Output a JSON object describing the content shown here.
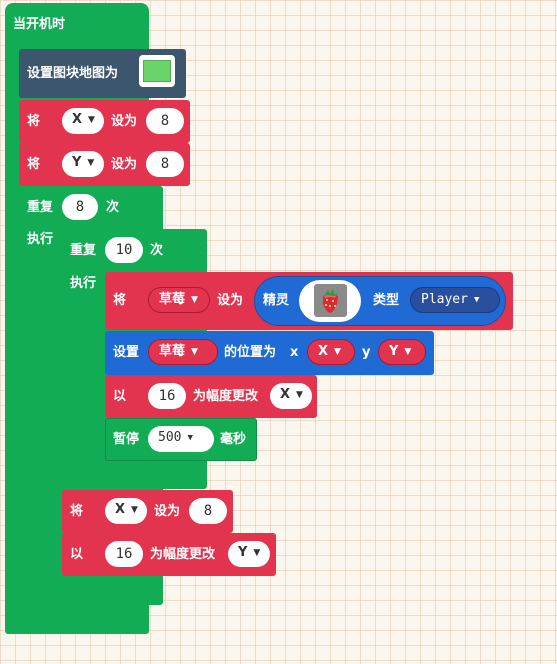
{
  "event": {
    "label": "当开机时"
  },
  "set_tilemap": {
    "label": "设置图块地图为",
    "preview_color": "#6ad36a"
  },
  "set_x": {
    "label": "将",
    "var": "X",
    "set_label": "设为",
    "value": "8"
  },
  "set_y": {
    "label": "将",
    "var": "Y",
    "set_label": "设为",
    "value": "8"
  },
  "outer_repeat": {
    "label": "重复",
    "count": "8",
    "times_label": "次",
    "do_label": "执行"
  },
  "inner_repeat": {
    "label": "重复",
    "count": "10",
    "times_label": "次",
    "do_label": "执行"
  },
  "set_sprite": {
    "label": "将",
    "var": "草莓",
    "set_label": "设为",
    "sprite_label": "精灵",
    "kind_label": "类型",
    "kind": "Player",
    "icon": "strawberry-icon"
  },
  "set_position": {
    "label": "设置",
    "var": "草莓",
    "pos_label": "的位置为",
    "x_label": "x",
    "x_var": "X",
    "y_label": "y",
    "y_var": "Y"
  },
  "change_x": {
    "label": "以",
    "amount": "16",
    "change_label": "为幅度更改",
    "var": "X"
  },
  "pause": {
    "label": "暂停",
    "ms": "500",
    "unit_label": "毫秒"
  },
  "reset_x": {
    "label": "将",
    "var": "X",
    "set_label": "设为",
    "value": "8"
  },
  "change_y": {
    "label": "以",
    "amount": "16",
    "change_label": "为幅度更改",
    "var": "Y"
  },
  "colors": {
    "loops": "#12ac55",
    "variables": "#e3344f",
    "sprites": "#1f6ad5",
    "scene": "#3c566e"
  }
}
